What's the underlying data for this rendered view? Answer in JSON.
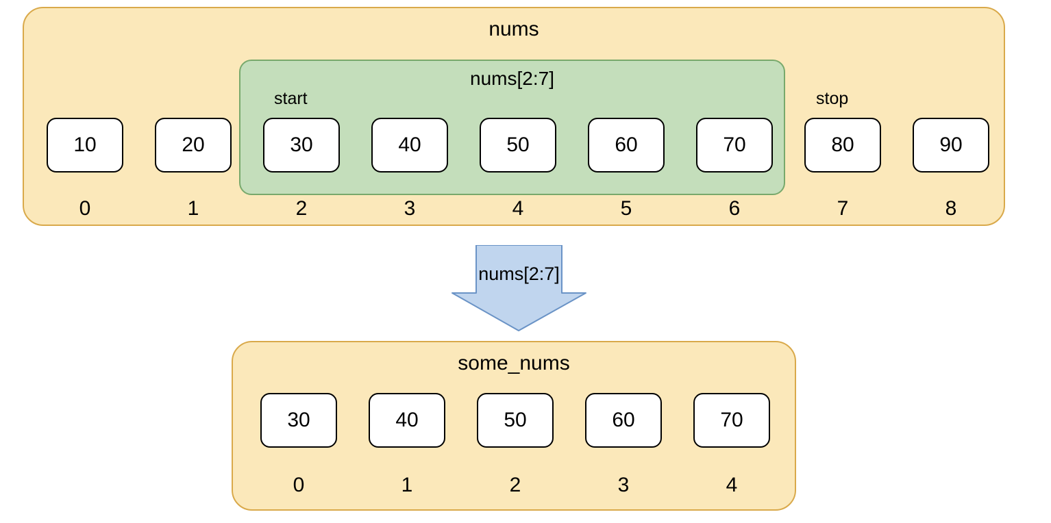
{
  "top_panel": {
    "title": "nums",
    "slice": {
      "title": "nums[2:7]",
      "start_label": "start",
      "stop_label": "stop"
    },
    "cells": [
      "10",
      "20",
      "30",
      "40",
      "50",
      "60",
      "70",
      "80",
      "90"
    ],
    "indices": [
      "0",
      "1",
      "2",
      "3",
      "4",
      "5",
      "6",
      "7",
      "8"
    ]
  },
  "arrow": {
    "label": "nums[2:7]"
  },
  "bottom_panel": {
    "title": "some_nums",
    "cells": [
      "30",
      "40",
      "50",
      "60",
      "70"
    ],
    "indices": [
      "0",
      "1",
      "2",
      "3",
      "4"
    ]
  }
}
